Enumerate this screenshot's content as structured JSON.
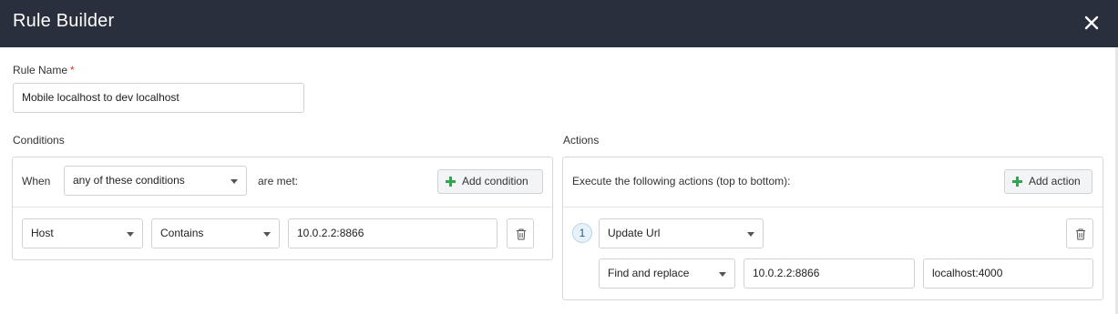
{
  "header": {
    "title": "Rule Builder",
    "close_icon": "close-icon"
  },
  "rule_name": {
    "label": "Rule Name",
    "required_mark": "*",
    "value": "Mobile localhost to dev localhost"
  },
  "conditions": {
    "section_label": "Conditions",
    "when_label": "When",
    "match_mode": "any of these conditions",
    "are_met_label": "are met:",
    "add_button_label": "Add condition",
    "rows": [
      {
        "field": "Host",
        "operator": "Contains",
        "value": "10.0.2.2:8866"
      }
    ]
  },
  "actions": {
    "section_label": "Actions",
    "intro": "Execute the following actions (top to bottom):",
    "add_button_label": "Add action",
    "items": [
      {
        "index": "1",
        "type": "Update Url",
        "mode": "Find and replace",
        "find": "10.0.2.2:8866",
        "replace": "localhost:4000"
      }
    ]
  },
  "colors": {
    "header_bg": "#2a2f3d",
    "accent_green": "#2aa84a",
    "required_red": "#d33333"
  }
}
